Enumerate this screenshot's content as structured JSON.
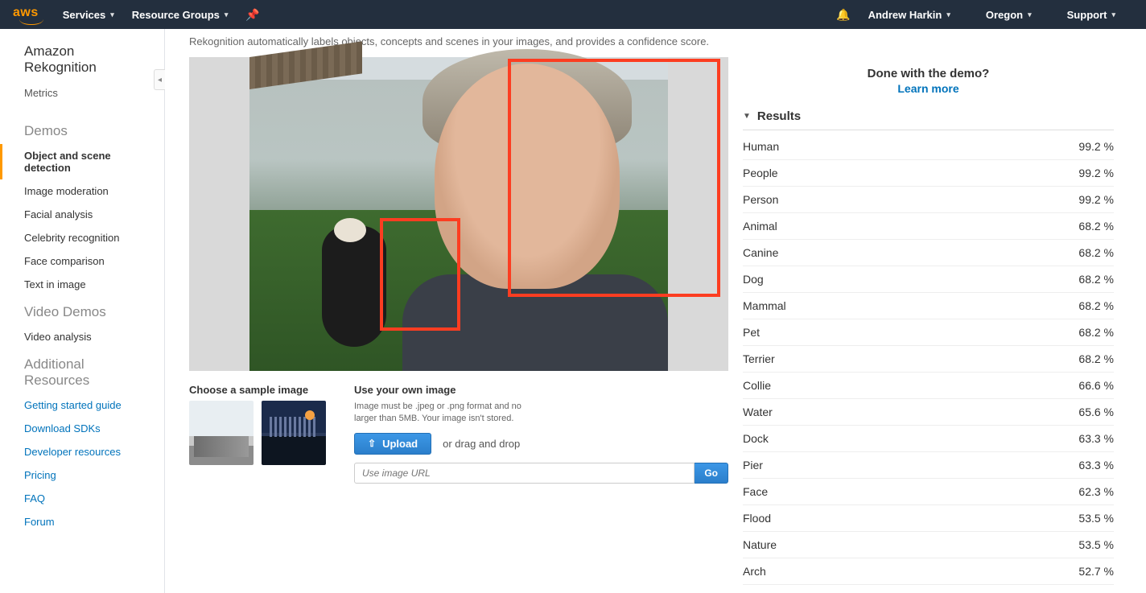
{
  "topnav": {
    "logo": "aws",
    "services": "Services",
    "resource_groups": "Resource Groups",
    "user": "Andrew Harkin",
    "region": "Oregon",
    "support": "Support"
  },
  "sidebar": {
    "title": "Amazon Rekognition",
    "metrics": "Metrics",
    "groups": [
      {
        "title": "Demos",
        "items": [
          {
            "label": "Object and scene detection",
            "active": true
          },
          {
            "label": "Image moderation"
          },
          {
            "label": "Facial analysis"
          },
          {
            "label": "Celebrity recognition"
          },
          {
            "label": "Face comparison"
          },
          {
            "label": "Text in image"
          }
        ]
      },
      {
        "title": "Video Demos",
        "items": [
          {
            "label": "Video analysis"
          }
        ]
      },
      {
        "title": "Additional Resources",
        "links": [
          "Getting started guide",
          "Download SDKs",
          "Developer resources",
          "Pricing",
          "FAQ",
          "Forum"
        ]
      }
    ]
  },
  "intro": "Rekognition automatically labels objects, concepts and scenes in your images, and provides a confidence score.",
  "sample": {
    "title": "Choose a sample image"
  },
  "own": {
    "title": "Use your own image",
    "note": "Image must be .jpeg or .png format and no larger than 5MB. Your image isn't stored.",
    "upload": "Upload",
    "drag": "or drag and drop",
    "url_placeholder": "Use image URL",
    "go": "Go"
  },
  "done": {
    "line1": "Done with the demo?",
    "line2": "Learn more"
  },
  "results_label": "Results",
  "results": [
    {
      "name": "Human",
      "conf": "99.2 %"
    },
    {
      "name": "People",
      "conf": "99.2 %"
    },
    {
      "name": "Person",
      "conf": "99.2 %"
    },
    {
      "name": "Animal",
      "conf": "68.2 %"
    },
    {
      "name": "Canine",
      "conf": "68.2 %"
    },
    {
      "name": "Dog",
      "conf": "68.2 %"
    },
    {
      "name": "Mammal",
      "conf": "68.2 %"
    },
    {
      "name": "Pet",
      "conf": "68.2 %"
    },
    {
      "name": "Terrier",
      "conf": "68.2 %"
    },
    {
      "name": "Collie",
      "conf": "66.6 %"
    },
    {
      "name": "Water",
      "conf": "65.6 %"
    },
    {
      "name": "Dock",
      "conf": "63.3 %"
    },
    {
      "name": "Pier",
      "conf": "63.3 %"
    },
    {
      "name": "Face",
      "conf": "62.3 %"
    },
    {
      "name": "Flood",
      "conf": "53.5 %"
    },
    {
      "name": "Nature",
      "conf": "53.5 %"
    },
    {
      "name": "Arch",
      "conf": "52.7 %"
    }
  ]
}
